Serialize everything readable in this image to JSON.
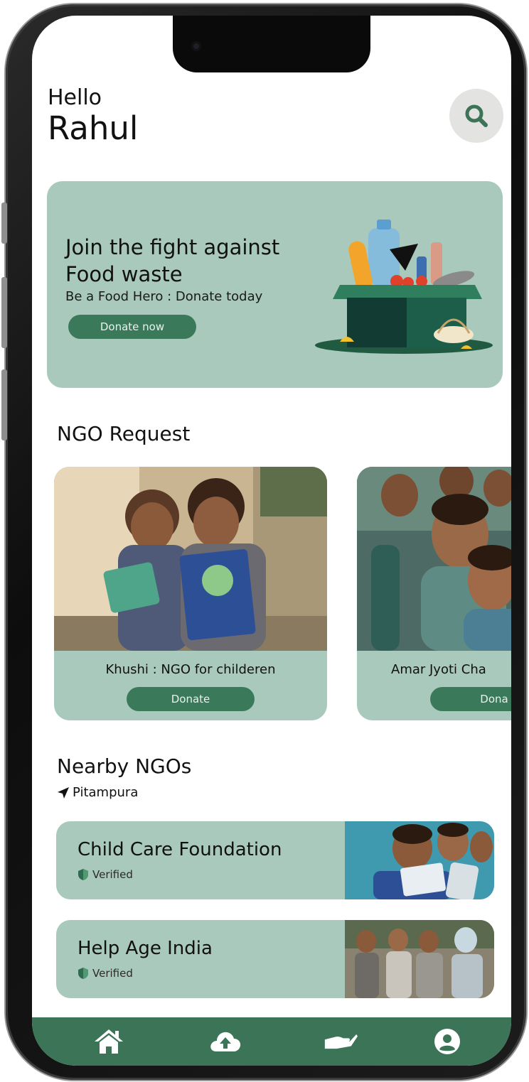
{
  "header": {
    "greeting": "Hello",
    "user_name": "Rahul",
    "search_icon": "search-icon"
  },
  "banner": {
    "title": "Join the fight against Food waste",
    "subtitle": "Be a Food Hero : Donate today",
    "button_label": "Donate now",
    "illustration": "food-donation-box-illustration"
  },
  "ngo_requests": {
    "title": "NGO Request",
    "cards": [
      {
        "name": "Khushi : NGO for childeren",
        "button_label": "Donate"
      },
      {
        "name": "Amar Jyoti Cha",
        "button_label": "Dona"
      }
    ]
  },
  "nearby": {
    "title": "Nearby NGOs",
    "location": "Pitampura",
    "location_icon": "navigation-arrow-icon",
    "items": [
      {
        "name": "Child Care Foundation",
        "badge": "Verified"
      },
      {
        "name": "Help Age India",
        "badge": "Verified"
      }
    ]
  },
  "bottom_nav": {
    "items": [
      "home-icon",
      "cloud-upload-icon",
      "hand-donate-icon",
      "profile-icon"
    ]
  },
  "colors": {
    "accent": "#3b7456",
    "card_bg": "#a8c9bb",
    "button": "#3a7a5a"
  }
}
